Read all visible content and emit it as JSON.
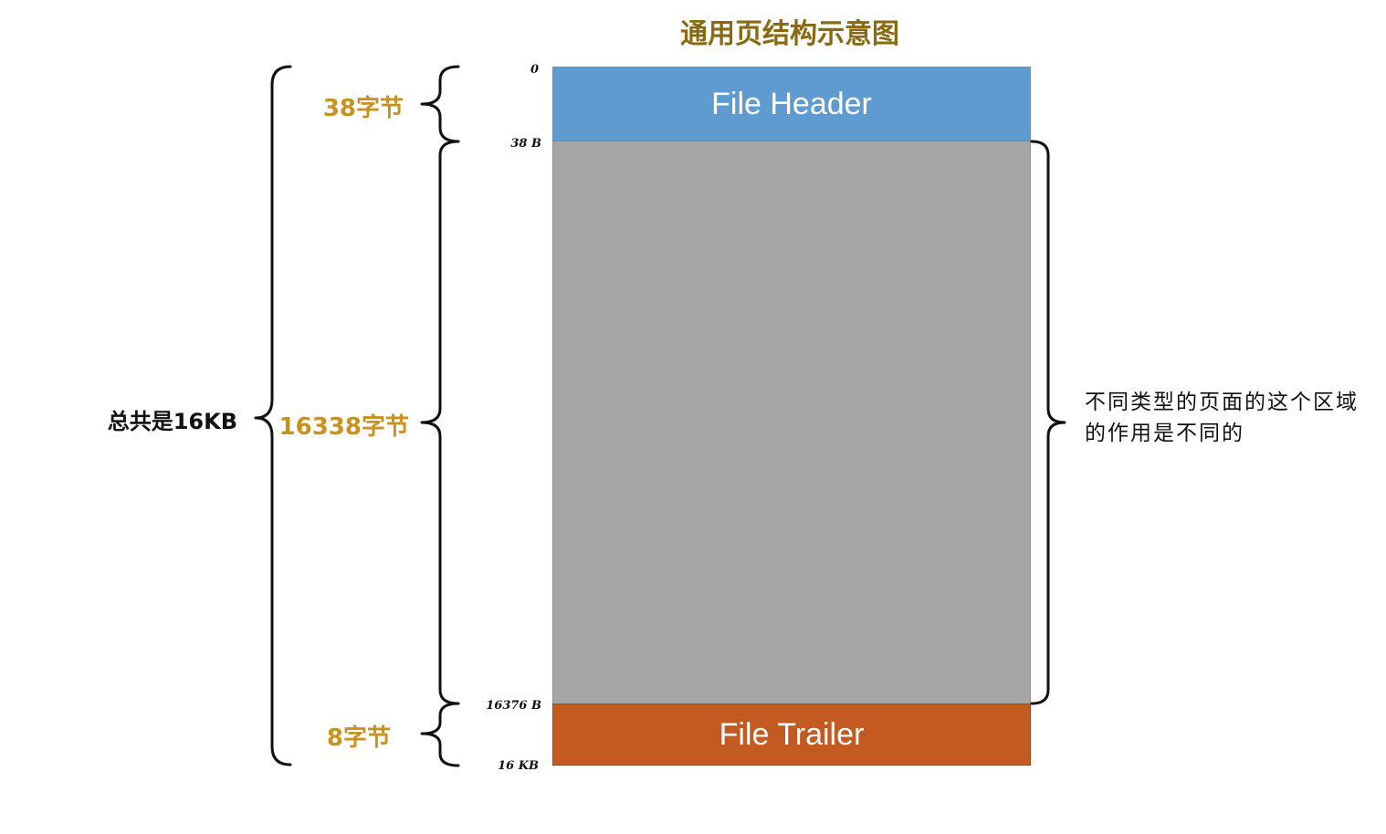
{
  "title": "通用页结构示意图",
  "blocks": {
    "header": "File Header",
    "trailer": "File Trailer"
  },
  "offsets": {
    "start": "0",
    "after_header": "38 B",
    "before_trailer": "16376 B",
    "end": "16 KB"
  },
  "sizes": {
    "header": "38字节",
    "body": "16338字节",
    "trailer": "8字节",
    "total": "总共是16KB"
  },
  "note": "不同类型的页面的这个区域的作用是不同的",
  "colors": {
    "header_block": "#5e9bd1",
    "body_block": "#a5a5a5",
    "trailer_block": "#c25a22",
    "size_label": "#c9921d",
    "title": "#8a6a10"
  }
}
